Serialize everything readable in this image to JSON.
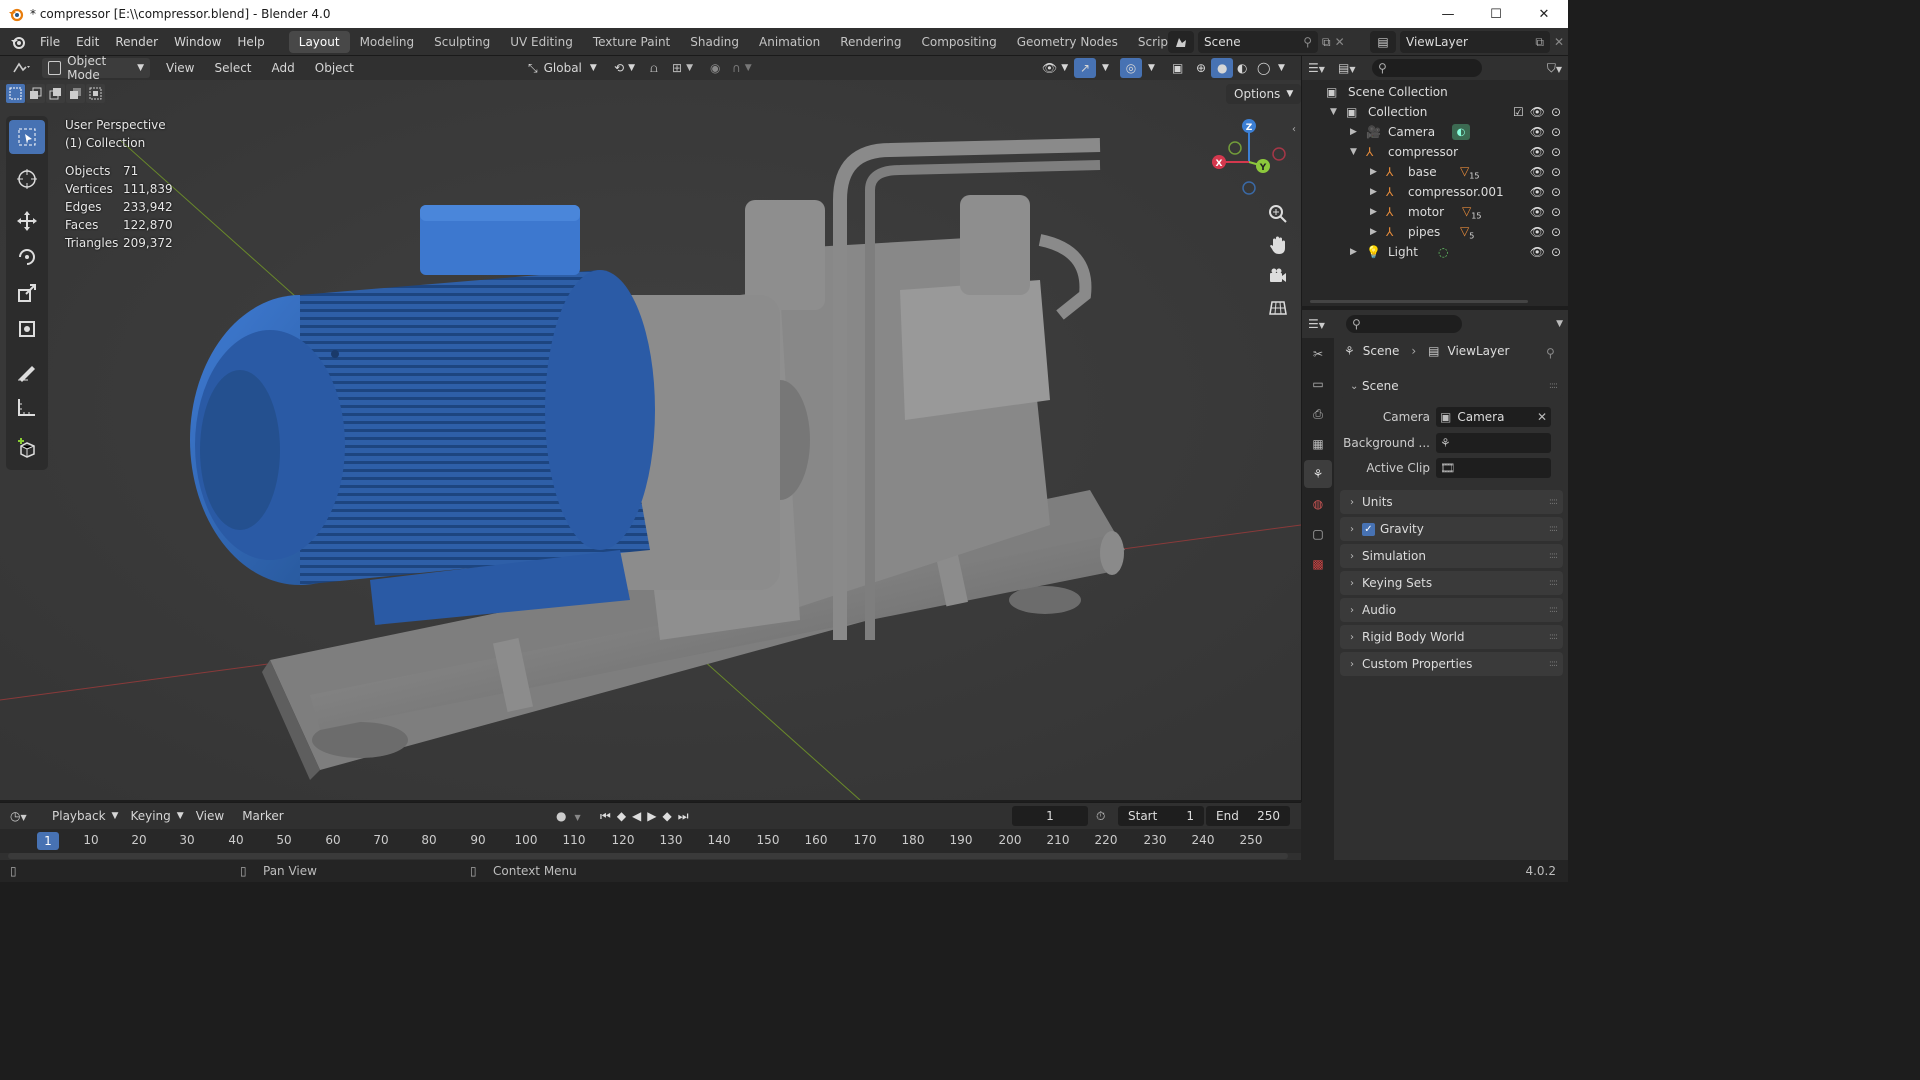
{
  "window": {
    "title": "* compressor [E:\\\\compressor.blend] - Blender 4.0",
    "minimize": "—",
    "maximize": "☐",
    "close": "✕"
  },
  "menubar": {
    "menus": [
      "File",
      "Edit",
      "Render",
      "Window",
      "Help"
    ],
    "workspaces": [
      "Layout",
      "Modeling",
      "Sculpting",
      "UV Editing",
      "Texture Paint",
      "Shading",
      "Animation",
      "Rendering",
      "Compositing",
      "Geometry Nodes",
      "Scripting"
    ],
    "active_workspace": "Layout",
    "add_workspace": "+",
    "scene": "Scene",
    "view_layer": "ViewLayer"
  },
  "viewport_header": {
    "mode": "Object Mode",
    "menus": [
      "View",
      "Select",
      "Add",
      "Object"
    ],
    "orientation": "Global"
  },
  "viewport": {
    "perspective": "User Perspective",
    "collection": "(1) Collection",
    "options": "Options",
    "stats": [
      {
        "label": "Objects",
        "value": "71"
      },
      {
        "label": "Vertices",
        "value": "111,839"
      },
      {
        "label": "Edges",
        "value": "233,942"
      },
      {
        "label": "Faces",
        "value": "122,870"
      },
      {
        "label": "Triangles",
        "value": "209,372"
      }
    ],
    "gizmo": {
      "x": "X",
      "y": "Y",
      "z": "Z"
    }
  },
  "outliner": {
    "root": "Scene Collection",
    "collection": "Collection",
    "items": [
      {
        "label": "Camera"
      },
      {
        "label": "compressor"
      },
      {
        "label": "base",
        "badge": "15"
      },
      {
        "label": "compressor.001"
      },
      {
        "label": "motor",
        "badge": "15"
      },
      {
        "label": "pipes",
        "badge": "5"
      },
      {
        "label": "Light"
      }
    ]
  },
  "properties": {
    "breadcrumb": [
      "Scene",
      "ViewLayer"
    ],
    "scene_panel": "Scene",
    "camera_label": "Camera",
    "camera_value": "Camera",
    "background_label": "Background ...",
    "active_clip_label": "Active Clip",
    "panels": [
      "Units",
      "Gravity",
      "Simulation",
      "Keying Sets",
      "Audio",
      "Rigid Body World",
      "Custom Properties"
    ],
    "gravity_checked": true
  },
  "timeline": {
    "menus": [
      "Playback",
      "Keying",
      "View",
      "Marker"
    ],
    "current_frame": "1",
    "start_label": "Start",
    "start": "1",
    "end_label": "End",
    "end": "250",
    "ruler": [
      "1",
      "10",
      "20",
      "30",
      "40",
      "50",
      "60",
      "70",
      "80",
      "90",
      "100",
      "110",
      "120",
      "130",
      "140",
      "150",
      "160",
      "170",
      "180",
      "190",
      "200",
      "210",
      "220",
      "230",
      "240",
      "250"
    ]
  },
  "statusbar": {
    "pan": "Pan View",
    "context": "Context Menu",
    "version": "4.0.2"
  },
  "colors": {
    "accent": "#4772b3",
    "motor_blue": "#2f63b3",
    "axis_x": "#d4384e",
    "axis_y": "#8cc83c",
    "axis_z": "#3c7fd4"
  }
}
